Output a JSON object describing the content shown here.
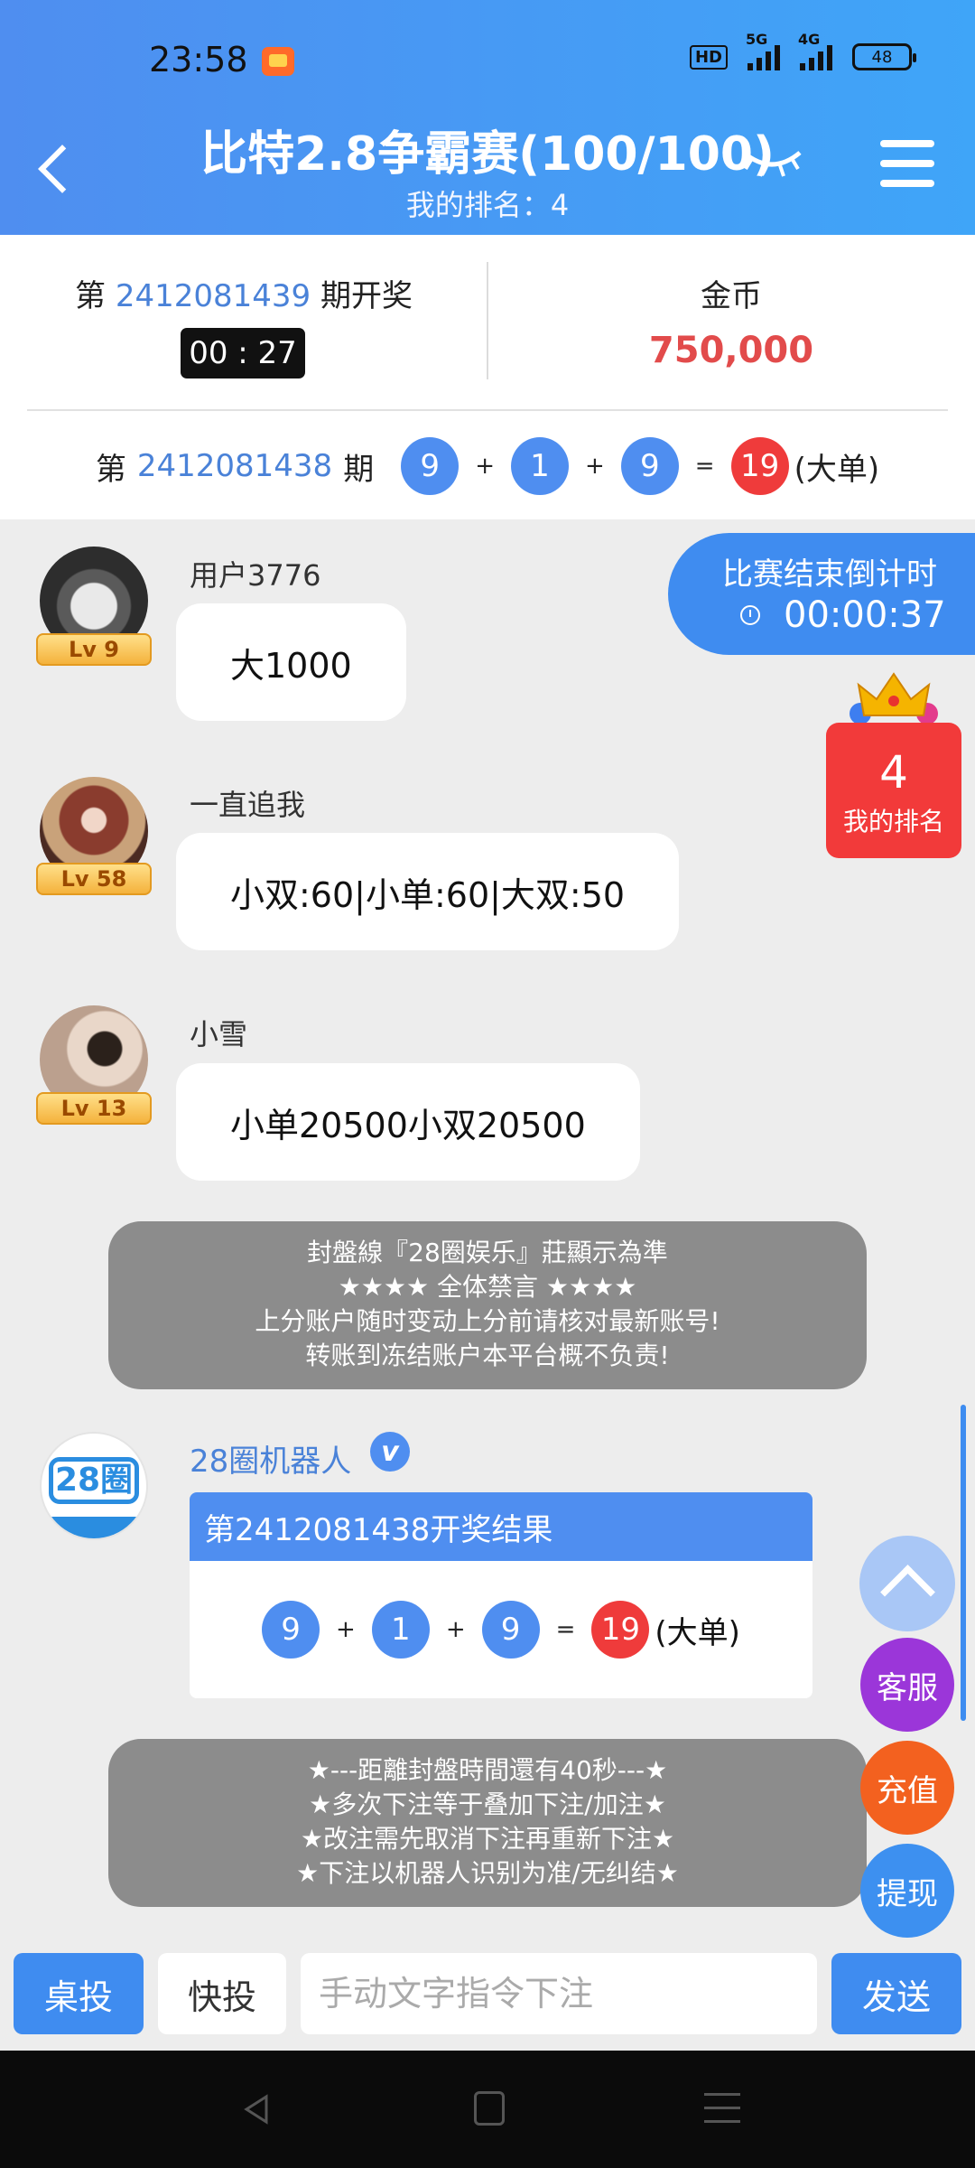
{
  "status_bar": {
    "time": "23:58",
    "network_1": "5G",
    "network_2": "4G",
    "hd": "HD",
    "battery": "48"
  },
  "header": {
    "title": "比特2.8争霸赛(100/100)",
    "subtitle": "我的排名：4"
  },
  "draw_info": {
    "current_prefix": "第",
    "current_period": "2412081439",
    "current_suffix": "期开奖",
    "countdown": "00 : 27",
    "gold_label": "金币",
    "gold_value": "750,000",
    "last_prefix": "第",
    "last_period": "2412081438",
    "last_suffix": "期",
    "last_balls": [
      "9",
      "1",
      "9"
    ],
    "last_sum": "19",
    "last_result": "(大单)"
  },
  "messages": [
    {
      "username": "用户3776",
      "level": "Lv 9",
      "text": "大1000"
    },
    {
      "username": "一直追我",
      "level": "Lv 58",
      "text": "小双:60|小单:60|大双:50"
    },
    {
      "username": "小雪",
      "level": "Lv 13",
      "text": "小单20500小双20500"
    }
  ],
  "notice_1": [
    "封盤線『28圈娱乐』莊顯示為準",
    "★★★★ 全体禁言 ★★★★",
    "上分账户随时变动上分前请核对最新账号!",
    "转账到冻结账户本平台概不负责!"
  ],
  "robot": {
    "name": "28圈机器人",
    "verified": "v",
    "logo": "28圈",
    "card_title": "第2412081438开奖结果",
    "balls": [
      "9",
      "1",
      "9"
    ],
    "sum": "19",
    "result": "(大单)"
  },
  "notice_2": [
    "★---距離封盤時間還有40秒---★",
    "★多次下注等于叠加下注/加注★",
    "★改注需先取消下注再重新下注★",
    "★下注以机器人识别为准/无纠结★"
  ],
  "match_countdown": {
    "label": "比赛结束倒计时",
    "value": "00:00:37"
  },
  "my_rank": {
    "value": "4",
    "label": "我的排名"
  },
  "fabs": {
    "service": "客服",
    "recharge": "充值",
    "withdraw": "提现"
  },
  "input_bar": {
    "btn_1": "桌投",
    "btn_2": "快投",
    "placeholder": "手动文字指令下注",
    "send": "发送"
  },
  "colors": {
    "primary": "#3f8cf0",
    "red": "#ef3b3b",
    "gold_text": "#e24b4b"
  }
}
